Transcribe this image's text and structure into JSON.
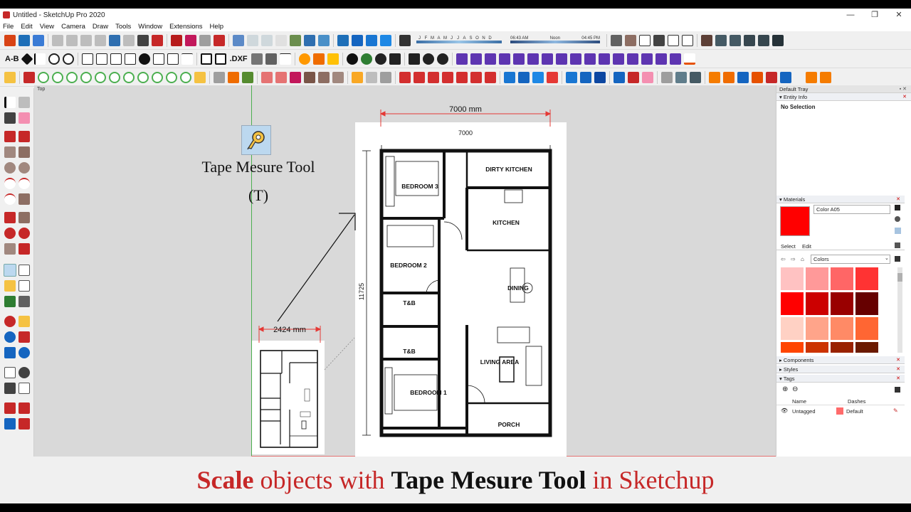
{
  "window": {
    "title": "Untitled - SketchUp Pro 2020",
    "controls": [
      "—",
      "❐",
      "✕"
    ]
  },
  "menu": [
    "File",
    "Edit",
    "View",
    "Camera",
    "Draw",
    "Tools",
    "Window",
    "Extensions",
    "Help"
  ],
  "shadows": {
    "months": [
      "J",
      "F",
      "M",
      "A",
      "M",
      "J",
      "J",
      "A",
      "S",
      "O",
      "N",
      "D"
    ],
    "time_start": "06:43 AM",
    "time_mid": "Noon",
    "time_end": "04:45 PM"
  },
  "toolbar": {
    "text_label": "A-B",
    "dxf_label": ".DXF"
  },
  "viewport": {
    "view_label": "Top",
    "tool_name": "Tape Mesure Tool",
    "tool_shortcut": "(T)",
    "top_dimension": "7000 mm",
    "small_dimension": "2424 mm",
    "plan": {
      "width_label": "7000",
      "height_label": "11725",
      "rooms": [
        "DIRTY KITCHEN",
        "BEDROOM 3",
        "KITCHEN",
        "BEDROOM 2",
        "DINING",
        "T&B",
        "T&B",
        "LIVING AREA",
        "BEDROOM 1",
        "PORCH"
      ]
    }
  },
  "tray": {
    "title": "Default Tray",
    "entity_info": {
      "header": "Entity Info",
      "status": "No Selection"
    },
    "materials": {
      "header": "Materials",
      "current_name": "Color A05",
      "current_color": "#ff0000",
      "tabs": [
        "Select",
        "Edit"
      ],
      "library": "Colors",
      "swatches": [
        "#ffc2c2",
        "#ff9999",
        "#ff6666",
        "#ff3333",
        "#ff0000",
        "#cc0000",
        "#990000",
        "#660000",
        "#ffd1c4",
        "#ffa48a",
        "#ff8a66",
        "#ff6633",
        "#ff4500",
        "#cc3300",
        "#992200",
        "#6b1a00"
      ]
    },
    "panels": [
      "Components",
      "Styles",
      "Tags"
    ],
    "tags": {
      "columns": [
        "Name",
        "Dashes"
      ],
      "row": {
        "name": "Untagged",
        "dashes": "Default",
        "color": "#ff6b6b"
      }
    }
  },
  "caption": {
    "part1": "Scale",
    "part2": " objects with ",
    "part3": "Tape Mesure Tool",
    "part4": " in Sketchup"
  }
}
